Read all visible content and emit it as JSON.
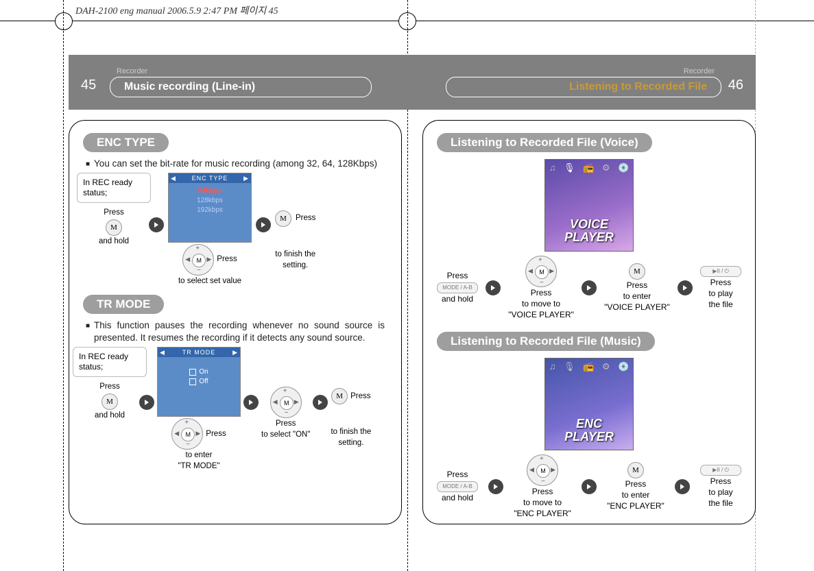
{
  "doc_header": "DAH-2100 eng manual  2006.5.9 2:47 PM 페이지 45",
  "left": {
    "section": "Recorder",
    "page_num": "45",
    "title": "Music recording (Line-in)",
    "enc_type": {
      "label": "ENC TYPE",
      "desc": "You can set the bit-rate for music recording (among 32, 64, 128Kbps)",
      "callout": "In REC ready status;",
      "step1_a": "Press",
      "step1_b": "and hold",
      "step2": "Press",
      "step2_cap": "to select set value",
      "step3": "Press",
      "step3_cap_a": "to finish the",
      "step3_cap_b": "setting.",
      "screen_title": "ENC TYPE",
      "screen_opts": [
        "64kbps",
        "128kbps",
        "192kbps"
      ]
    },
    "tr_mode": {
      "label": "TR MODE",
      "desc": "This function pauses the recording whenever no sound source is presented. It resumes the recording if it detects any sound source.",
      "callout": "In REC ready status;",
      "step1_a": "Press",
      "step1_b": "and hold",
      "step2": "Press",
      "step2_cap_a": "to enter",
      "step2_cap_b": "\"TR MODE\"",
      "step3_a": "Press",
      "step3_b": "to select \"ON\"",
      "step4": "Press",
      "step4_cap_a": "to finish the",
      "step4_cap_b": "setting.",
      "screen_title": "TR  MODE",
      "screen_opts": [
        "On",
        "Off"
      ]
    }
  },
  "right": {
    "section": "Recorder",
    "page_num": "46",
    "title": "Listening to Recorded File",
    "voice": {
      "label": "Listening to Recorded File (Voice)",
      "screen_text_a": "VOICE",
      "screen_text_b": "PLAYER",
      "s1_a": "Press",
      "s1_b": "and hold",
      "s1_btn": "MODE / A-B",
      "s2_a": "Press",
      "s2_b": "to move to",
      "s2_c": "\"VOICE PLAYER\"",
      "s3_a": "Press",
      "s3_b": "to enter",
      "s3_c": "\"VOICE PLAYER\"",
      "s4_a": "Press",
      "s4_b": "to play",
      "s4_c": "the file",
      "s4_btn": "▶II / ⏻"
    },
    "music": {
      "label": "Listening to Recorded File (Music)",
      "screen_text_a": "ENC",
      "screen_text_b": "PLAYER",
      "s1_a": "Press",
      "s1_b": "and hold",
      "s1_btn": "MODE / A-B",
      "s2_a": "Press",
      "s2_b": "to move to",
      "s2_c": "\"ENC PLAYER\"",
      "s3_a": "Press",
      "s3_b": "to enter",
      "s3_c": "\"ENC PLAYER\"",
      "s4_a": "Press",
      "s4_b": "to play",
      "s4_c": "the file",
      "s4_btn": "▶II / ⏻"
    }
  }
}
